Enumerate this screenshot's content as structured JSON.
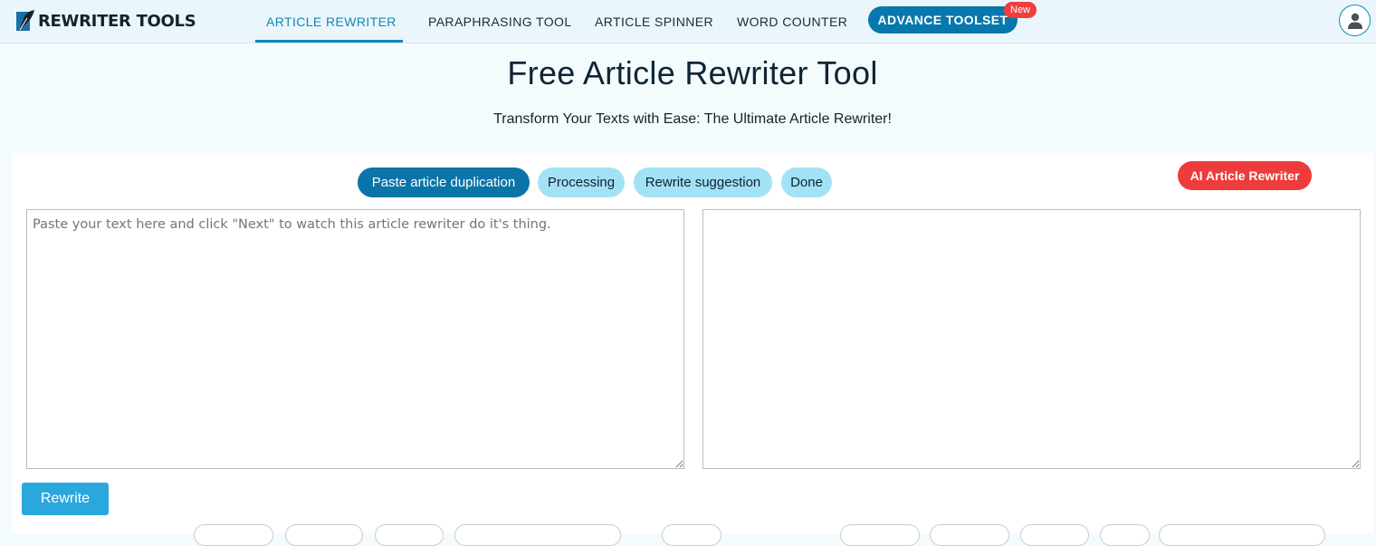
{
  "brand": {
    "name": "REWRITER TOOLS",
    "logo_icon": "quill-logo-icon"
  },
  "nav": {
    "items": [
      {
        "label": "ARTICLE REWRITER",
        "active": true
      },
      {
        "label": "PARAPHRASING TOOL",
        "active": false
      },
      {
        "label": "ARTICLE SPINNER",
        "active": false
      },
      {
        "label": "WORD COUNTER",
        "active": false
      }
    ],
    "advance_label": "ADVANCE TOOLSET",
    "new_badge": "New",
    "avatar_icon": "user-icon"
  },
  "hero": {
    "title": "Free Article Rewriter Tool",
    "subtitle": "Transform Your Texts with Ease: The Ultimate Article Rewriter!"
  },
  "steps": [
    {
      "label": "Paste article duplication",
      "active": true
    },
    {
      "label": "Processing",
      "active": false
    },
    {
      "label": "Rewrite suggestion",
      "active": false
    },
    {
      "label": "Done",
      "active": false
    }
  ],
  "ai_button": "AI Article Rewriter",
  "input": {
    "value": "",
    "placeholder": "Paste your text here and click \"Next\" to watch this article rewriter do it's thing."
  },
  "output": {
    "value": ""
  },
  "rewrite_button": "Rewrite",
  "colors": {
    "accent": "#0b74a8",
    "active_nav": "#1686b8",
    "step_inactive": "#a3e1f6",
    "ai_red": "#ee3b3b",
    "rewrite_blue": "#2aa8de"
  }
}
